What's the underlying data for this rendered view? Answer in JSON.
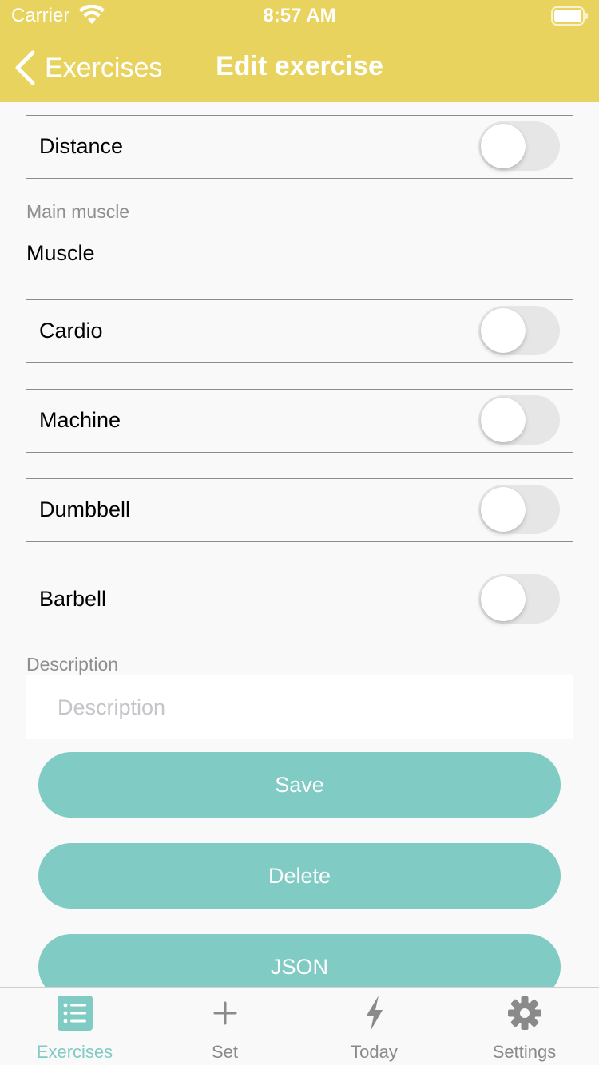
{
  "status_bar": {
    "carrier": "Carrier",
    "time": "8:57 AM"
  },
  "nav": {
    "back_label": "Exercises",
    "title": "Edit exercise"
  },
  "toggles": {
    "distance": {
      "label": "Distance",
      "on": false
    },
    "cardio": {
      "label": "Cardio",
      "on": false
    },
    "machine": {
      "label": "Machine",
      "on": false
    },
    "dumbbell": {
      "label": "Dumbbell",
      "on": false
    },
    "barbell": {
      "label": "Barbell",
      "on": false
    }
  },
  "main_muscle": {
    "label": "Main muscle",
    "value": "Muscle"
  },
  "description": {
    "label": "Description",
    "placeholder": "Description",
    "value": ""
  },
  "buttons": {
    "save": "Save",
    "delete": "Delete",
    "json": "JSON"
  },
  "tabs": [
    {
      "label": "Exercises",
      "icon": "list-icon",
      "active": true
    },
    {
      "label": "Set",
      "icon": "plus-icon",
      "active": false
    },
    {
      "label": "Today",
      "icon": "bolt-icon",
      "active": false
    },
    {
      "label": "Settings",
      "icon": "gear-icon",
      "active": false
    }
  ],
  "colors": {
    "header": "#e8d35e",
    "accent": "#80cbc4",
    "background": "#f9f9f9"
  }
}
